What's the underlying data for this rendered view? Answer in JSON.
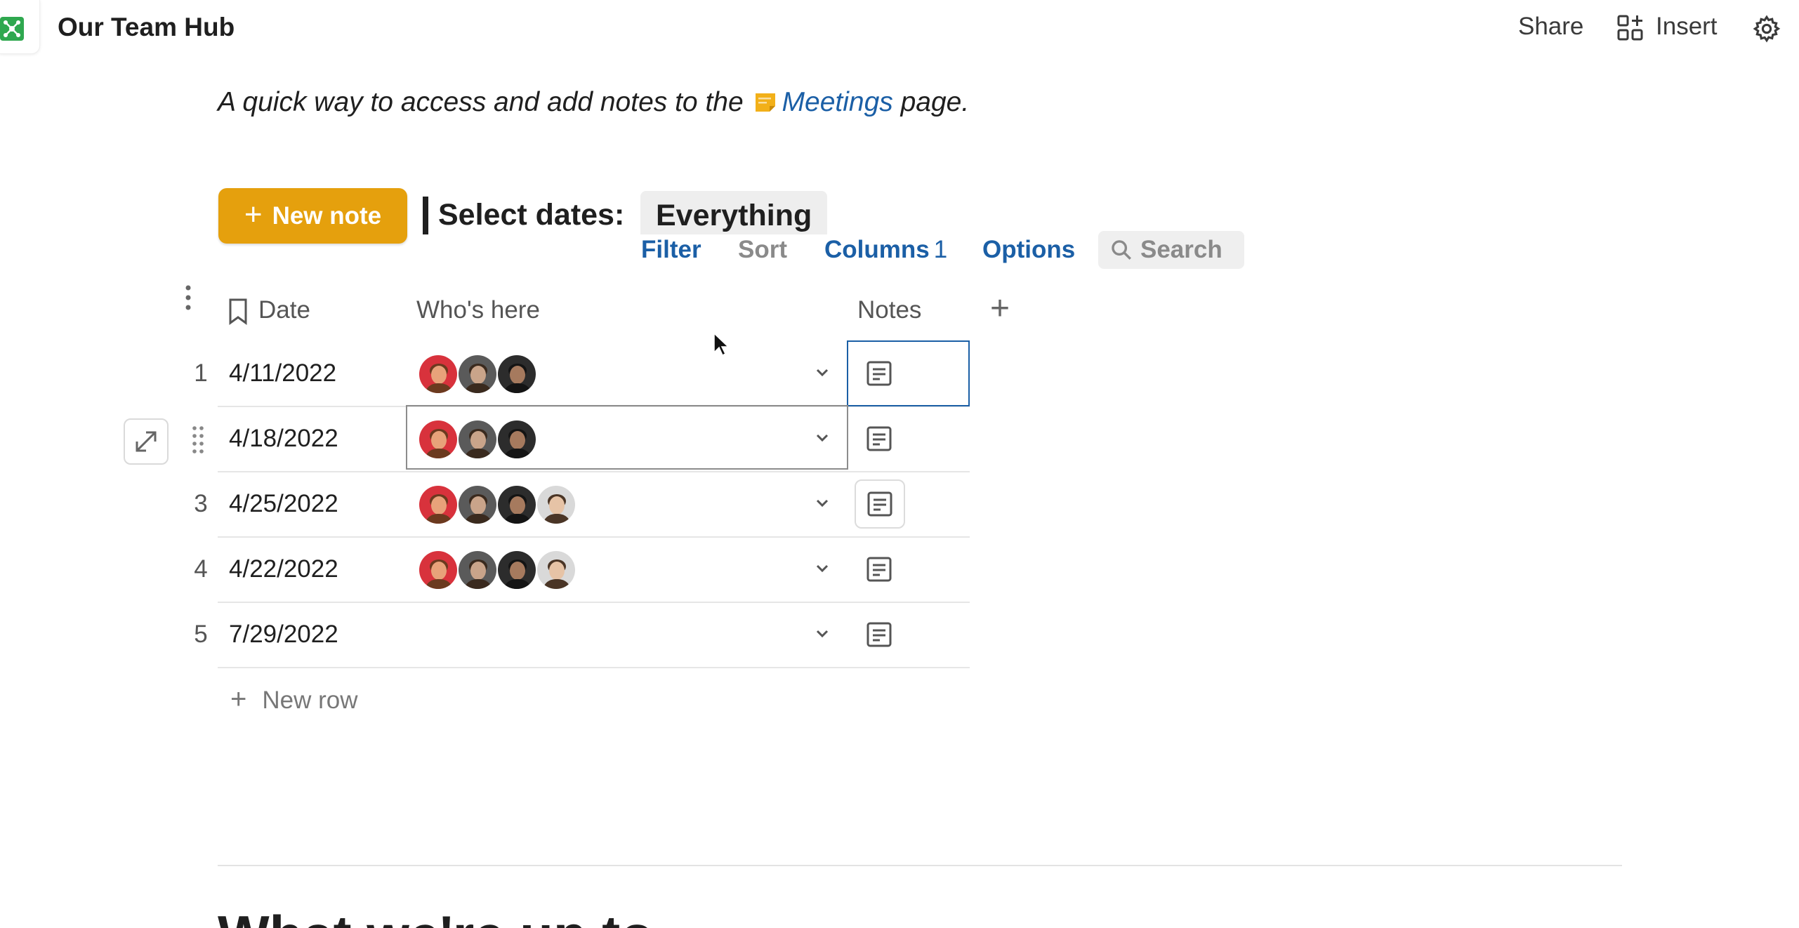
{
  "header": {
    "title": "Our Team Hub",
    "share_label": "Share",
    "insert_label": "Insert"
  },
  "intro": {
    "before": "A quick way to access and add notes to the",
    "link": "Meetings",
    "after": " page."
  },
  "toolbar": {
    "new_note_label": "New note",
    "select_dates_label": "Select dates:",
    "select_dates_value": "Everything",
    "filter_label": "Filter",
    "sort_label": "Sort",
    "columns_label": "Columns",
    "columns_count": "1",
    "options_label": "Options",
    "search_placeholder": "Search"
  },
  "table": {
    "columns": [
      "Date",
      "Who's here",
      "Notes"
    ],
    "rows": [
      {
        "num": "1",
        "date": "4/11/2022",
        "who": [
          "person-1",
          "person-2",
          "person-3"
        ]
      },
      {
        "num": "2",
        "date": "4/18/2022",
        "who": [
          "person-1",
          "person-2",
          "person-3"
        ]
      },
      {
        "num": "3",
        "date": "4/25/2022",
        "who": [
          "person-1",
          "person-2",
          "person-3",
          "person-4"
        ]
      },
      {
        "num": "4",
        "date": "4/22/2022",
        "who": [
          "person-1",
          "person-2",
          "person-3",
          "person-4"
        ]
      },
      {
        "num": "5",
        "date": "7/29/2022",
        "who": []
      }
    ],
    "new_row_label": "New row"
  },
  "section": {
    "heading": "What we're up to"
  },
  "colors": {
    "accent": "#e5a00d",
    "link": "#1b5fa6",
    "logo": "#2fa84f"
  }
}
